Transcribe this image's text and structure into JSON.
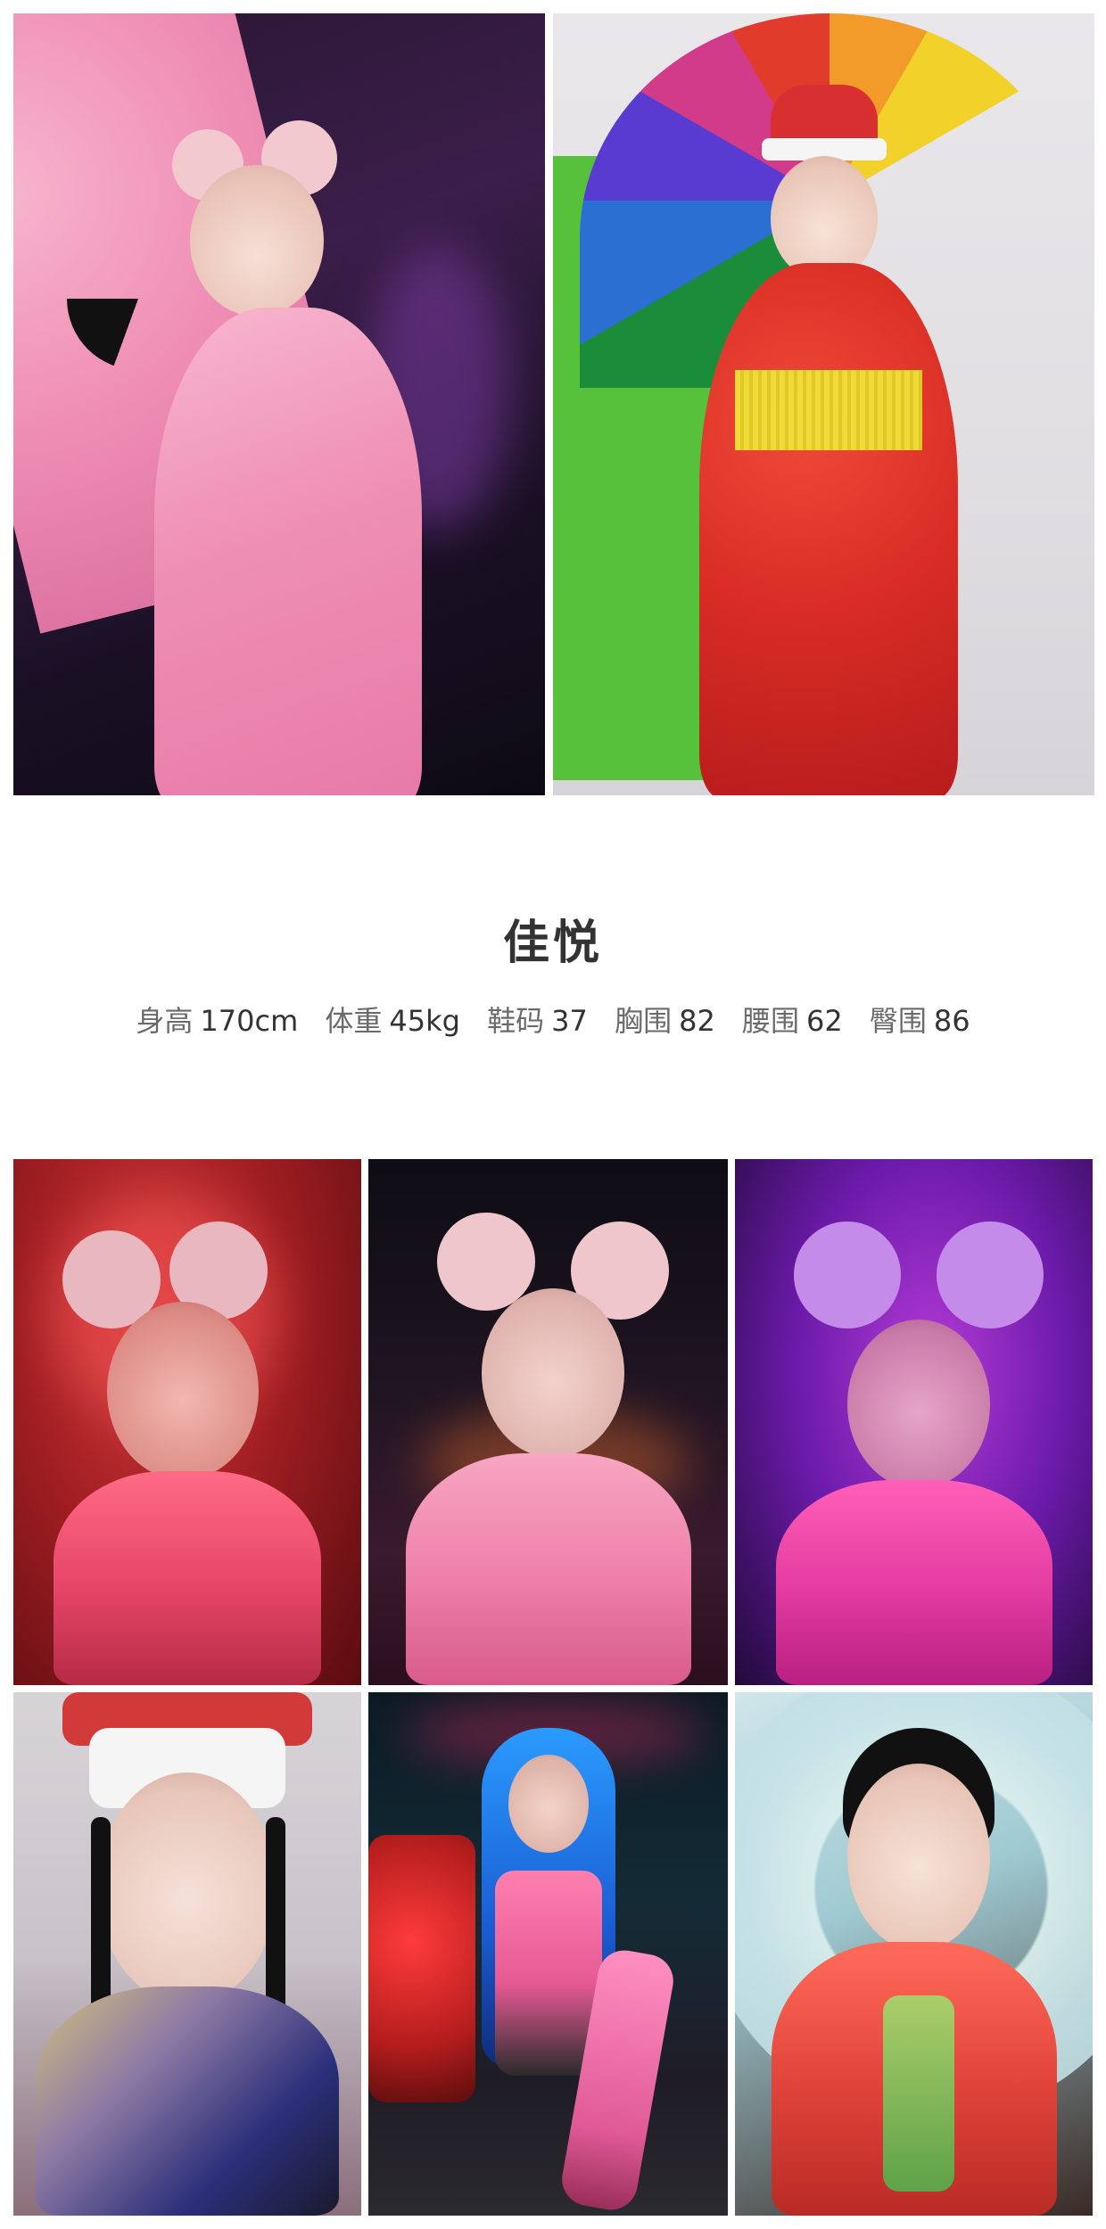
{
  "profile": {
    "name": "佳悦",
    "stats": [
      {
        "label": "身高",
        "value": "170cm"
      },
      {
        "label": "体重",
        "value": "45kg"
      },
      {
        "label": "鞋码",
        "value": "37"
      },
      {
        "label": "胸围",
        "value": "82"
      },
      {
        "label": "腰围",
        "value": "62"
      },
      {
        "label": "臀围",
        "value": "86"
      }
    ]
  },
  "colors": {
    "background": "#ffffff",
    "name_text": "#333333",
    "stat_label": "#6a6a6a",
    "stat_value": "#333333"
  },
  "photos": {
    "top": [
      {
        "subject": "pink qipao costume with large fan, neon background"
      },
      {
        "subject": "red floral costume with rainbow umbrella"
      }
    ],
    "grid": [
      {
        "subject": "pink twin-bun wig, red light"
      },
      {
        "subject": "pink twin-bun wig, dark bar"
      },
      {
        "subject": "pink twin-bun wig, purple light"
      },
      {
        "subject": "white hat, painted face makeup"
      },
      {
        "subject": "blue braided wig, neon sign"
      },
      {
        "subject": "red hanfu with painted parasol"
      }
    ]
  }
}
